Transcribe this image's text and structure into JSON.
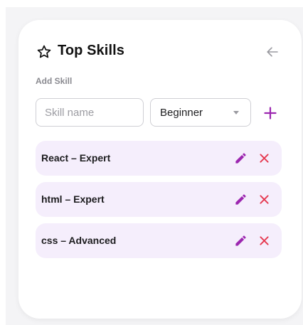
{
  "panel": {
    "title": "Top Skills",
    "title_icon": "star-outline-icon",
    "back_icon": "arrow-left-icon"
  },
  "add_skill": {
    "label": "Add Skill",
    "input_placeholder": "Skill name",
    "input_value": "",
    "level_selected": "Beginner",
    "add_icon": "plus-icon"
  },
  "skills": [
    {
      "text": "React – Expert"
    },
    {
      "text": "html – Expert"
    },
    {
      "text": "css – Advanced"
    }
  ],
  "colors": {
    "accent": "#9c27b0",
    "delete": "#e53950",
    "row_background": "#f5eefc",
    "page_background": "#f4f4f6"
  }
}
